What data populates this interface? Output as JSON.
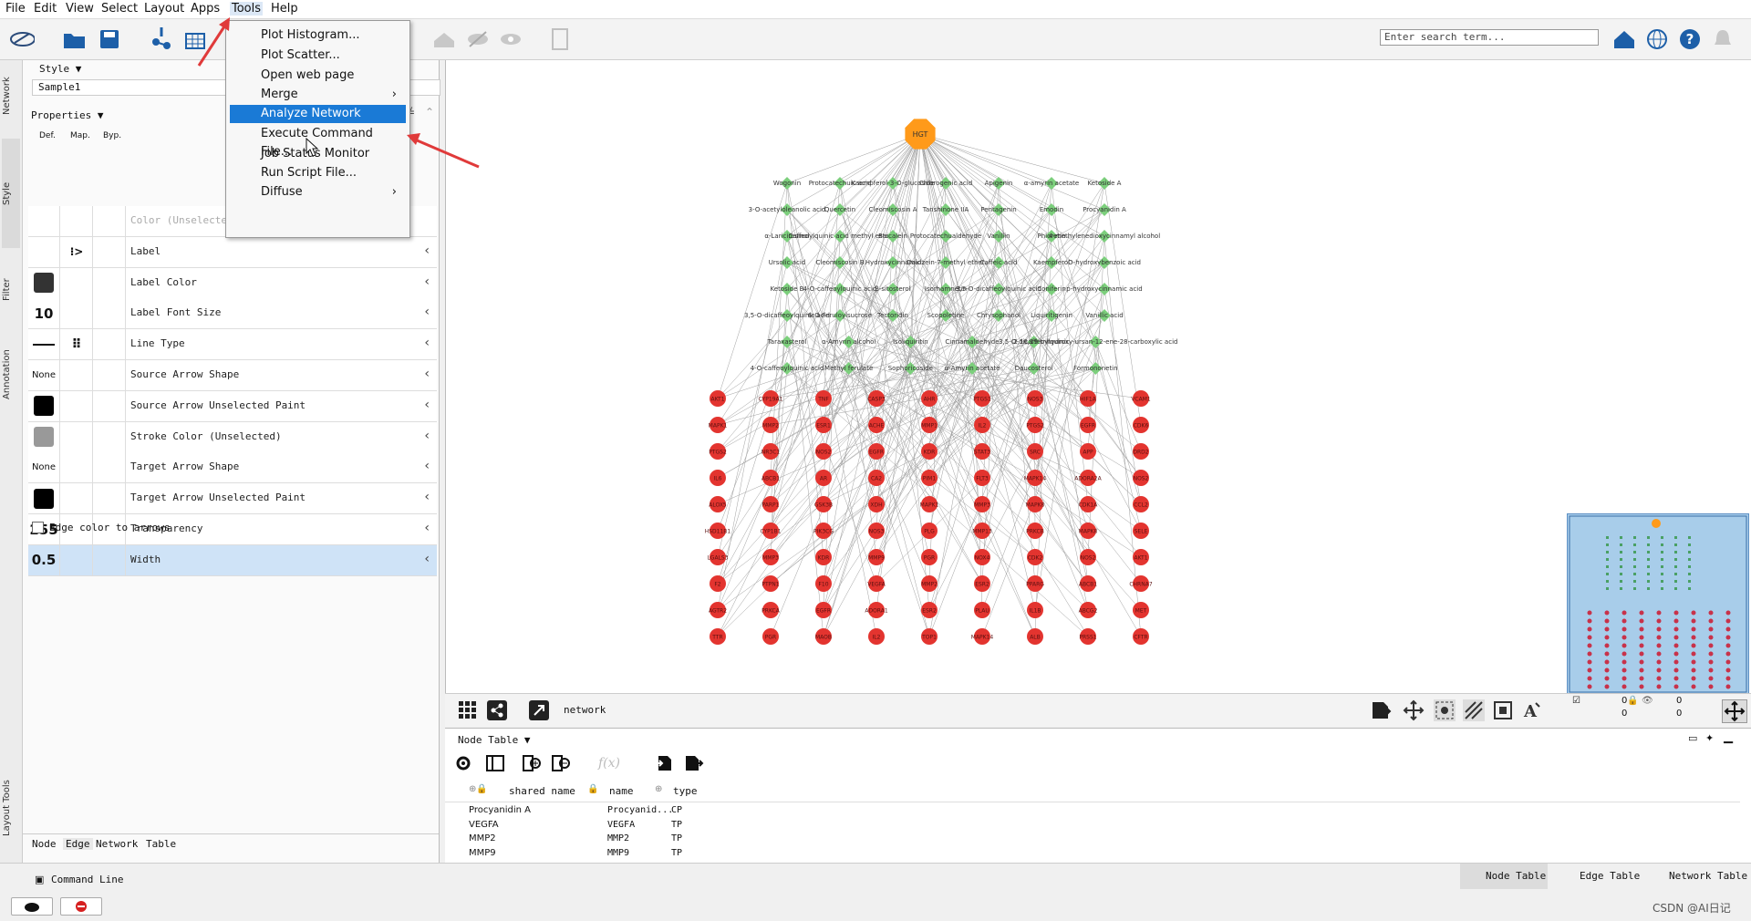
{
  "menubar": {
    "items": [
      "File",
      "Edit",
      "View",
      "Select",
      "Layout",
      "Apps",
      "Tools",
      "Help"
    ]
  },
  "tools_menu": {
    "items": [
      {
        "label": "Plot Histogram...",
        "submenu": false
      },
      {
        "label": "Plot Scatter...",
        "submenu": false
      },
      {
        "label": "Open web page",
        "submenu": false
      },
      {
        "label": "Merge",
        "submenu": true
      },
      {
        "label": "Analyze Network",
        "submenu": false,
        "highlighted": true
      },
      {
        "label": "Execute Command File...",
        "submenu": false
      },
      {
        "label": "Job Status Monitor",
        "submenu": false
      },
      {
        "label": "Run Script File...",
        "submenu": false
      },
      {
        "label": "Diffuse",
        "submenu": true
      }
    ],
    "submenu_arrow": "›"
  },
  "toolbar": {
    "search_placeholder": "Enter search term..."
  },
  "left_tabs": [
    "Network",
    "Style",
    "Filter",
    "Annotation",
    "Layout Tools"
  ],
  "style_panel": {
    "style_label": "Style ▼",
    "style_name": "Sample1",
    "properties_label": "Properties ▼",
    "col_def": "Def.",
    "col_map": "Map.",
    "col_byp": "Byp.",
    "rows": [
      {
        "name": "Color (Unselected)",
        "def_type": "empty"
      },
      {
        "name": "Label",
        "def_type": "empty"
      },
      {
        "name": "Label Color",
        "def_type": "swatch",
        "color": "#333333"
      },
      {
        "name": "Label Font Size",
        "def_type": "text",
        "value": "10"
      },
      {
        "name": "Line Type",
        "def_type": "line"
      },
      {
        "name": "Source Arrow Shape",
        "def_type": "small",
        "value": "None"
      },
      {
        "name": "Source Arrow Unselected Paint",
        "def_type": "swatch",
        "color": "#000000"
      },
      {
        "name": "Stroke Color (Unselected)",
        "def_type": "swatch",
        "color": "#999999"
      },
      {
        "name": "Target Arrow Shape",
        "def_type": "small",
        "value": "None"
      },
      {
        "name": "Target Arrow Unselected Paint",
        "def_type": "swatch",
        "color": "#000000"
      },
      {
        "name": "Transparency",
        "def_type": "text",
        "value": "255"
      },
      {
        "name": "Width",
        "def_type": "text",
        "value": "0.5",
        "selected": true
      }
    ],
    "edge_color_checkbox": "Edge color to arrows",
    "bottom_tabs": [
      "Node",
      "Edge",
      "Network",
      "Table"
    ]
  },
  "network": {
    "hub_label": "HGT",
    "compound_rows": [
      [
        "Wogonin",
        "Protocatechuic acid",
        "Kaempferol-3-O-glucoside",
        "Chlorogenic acid",
        "Apigenin",
        "α-amyrin acetate",
        "Ketoside A"
      ],
      [
        "3-O-acetyloleanolic acid",
        "Quercetin",
        "Cleomiscosin A",
        "Tanshinone IIA",
        "Pentagenin",
        "Emodin",
        "Procyanidin A"
      ],
      [
        "α-Lariciresinol",
        "Caffeoylquinic acid methyl ester",
        "Baicalein",
        "Protocatechualdehyde",
        "Vanillin",
        "Phloretin",
        "4-methylenedioxycinnamyl alcohol"
      ],
      [
        "Ursolic acid",
        "Cleomiscosin B",
        "Hydroxycinnamic",
        "Daidzein-7-methyl ether",
        "Caffeic acid",
        "Kaempferol",
        "O-hydroxybenzoic acid"
      ],
      [
        "Ketoside B",
        "4-O-caffeoylquinic acid",
        "β-sitosterol",
        "Isorhamnetin",
        "3,5-O-dicaffeoylquinic acid",
        "Coniferin",
        "p-hydroxycinnamic acid"
      ],
      [
        "3,5-O-dicaffeoylquinic acid",
        "6-O-Feruloylsucrose",
        "Tectoridin",
        "Scopoletine",
        "Chrysophanol",
        "Liquiritigenin",
        "Vanillic acid"
      ],
      [
        "Taraxasterol",
        "α-Amyrin alcohol",
        "Isoliquiritin",
        "Cinnamaldehyde",
        "3,5-O-dicaffeoylquinic",
        "2,16,19-trihydroxy-ursan-12-ene-28-carboxylic acid"
      ],
      [
        "4-O-caffeoylquinic acid",
        "Methyl ferulate",
        "Sophoricoside",
        "α-Amyrin acetate",
        "Daucosterol",
        "Formononetin"
      ]
    ],
    "target_columns": [
      [
        "AKT1",
        "MAPK1",
        "PTGS2",
        "IL6",
        "ALOX5",
        "HSD11B1",
        "LGALS3",
        "F2",
        "AGTR2",
        "TTR"
      ],
      [
        "CYP19A1",
        "MMP2",
        "NR3C1",
        "ABCB1",
        "PARP1",
        "CYP1B1",
        "MMP3",
        "PTPN1",
        "PRKCA",
        "PGR"
      ],
      [
        "TNF",
        "ESR1",
        "NOS2",
        "AR",
        "GSK3B",
        "PIK3CG",
        "KDR",
        "F10",
        "EGFR",
        "MAOB"
      ],
      [
        "CASP3",
        "ACHE",
        "EGFR",
        "CA2",
        "XDH",
        "NOS3",
        "MMP9",
        "VEGFA",
        "ADORA1",
        "IL2"
      ],
      [
        "AHR",
        "MMP1",
        "KDR",
        "PIM1",
        "MAPK1",
        "PLG",
        "PGR",
        "MMP2",
        "ESR2",
        "TOP1"
      ],
      [
        "PTGS1",
        "IL2",
        "STAT3",
        "FLT3",
        "MMP3",
        "MMP13",
        "NOX4",
        "ESR2",
        "PLAU",
        "MAPK14"
      ],
      [
        "NOS3",
        "PTGS2",
        "SRC",
        "MAPK14",
        "MAPK8",
        "PRKCB",
        "CDK2",
        "PPARG",
        "IL1B",
        "ALB"
      ],
      [
        "HIF1A",
        "EGFR",
        "APP",
        "ADORA2A",
        "CDK1A",
        "MAPK8",
        "NOS2",
        "ABCB1",
        "ABCG2",
        "PRSS1"
      ],
      [
        "VCAM1",
        "CDK6",
        "DRD2",
        "NOS2",
        "CCL2",
        "SELE",
        "AKT1",
        "CHRNA7",
        "MET",
        "CFTR"
      ]
    ],
    "name": "network",
    "nav_counts": [
      "0",
      "0",
      "0",
      "0"
    ]
  },
  "colors": {
    "hub": "#ff9a1a",
    "compound": "#7ccf7c",
    "target": "#e3342f",
    "accent": "#1a7ad6",
    "annotation_arrow": "#e03a3a"
  },
  "node_table": {
    "label": "Node Table ▼",
    "fx": "f(x)",
    "columns": [
      "shared name",
      "name",
      "type"
    ],
    "rows": [
      [
        "Procyanidin A",
        "Procyanid...",
        "CP"
      ],
      [
        "VEGFA",
        "VEGFA",
        "TP"
      ],
      [
        "MMP2",
        "MMP2",
        "TP"
      ],
      [
        "MMP9",
        "MMP9",
        "TP"
      ]
    ]
  },
  "status": {
    "command_line": "Command Line",
    "tabs": [
      "Node Table",
      "Edge Table",
      "Network Table"
    ],
    "watermark": "CSDN @AI日记"
  }
}
